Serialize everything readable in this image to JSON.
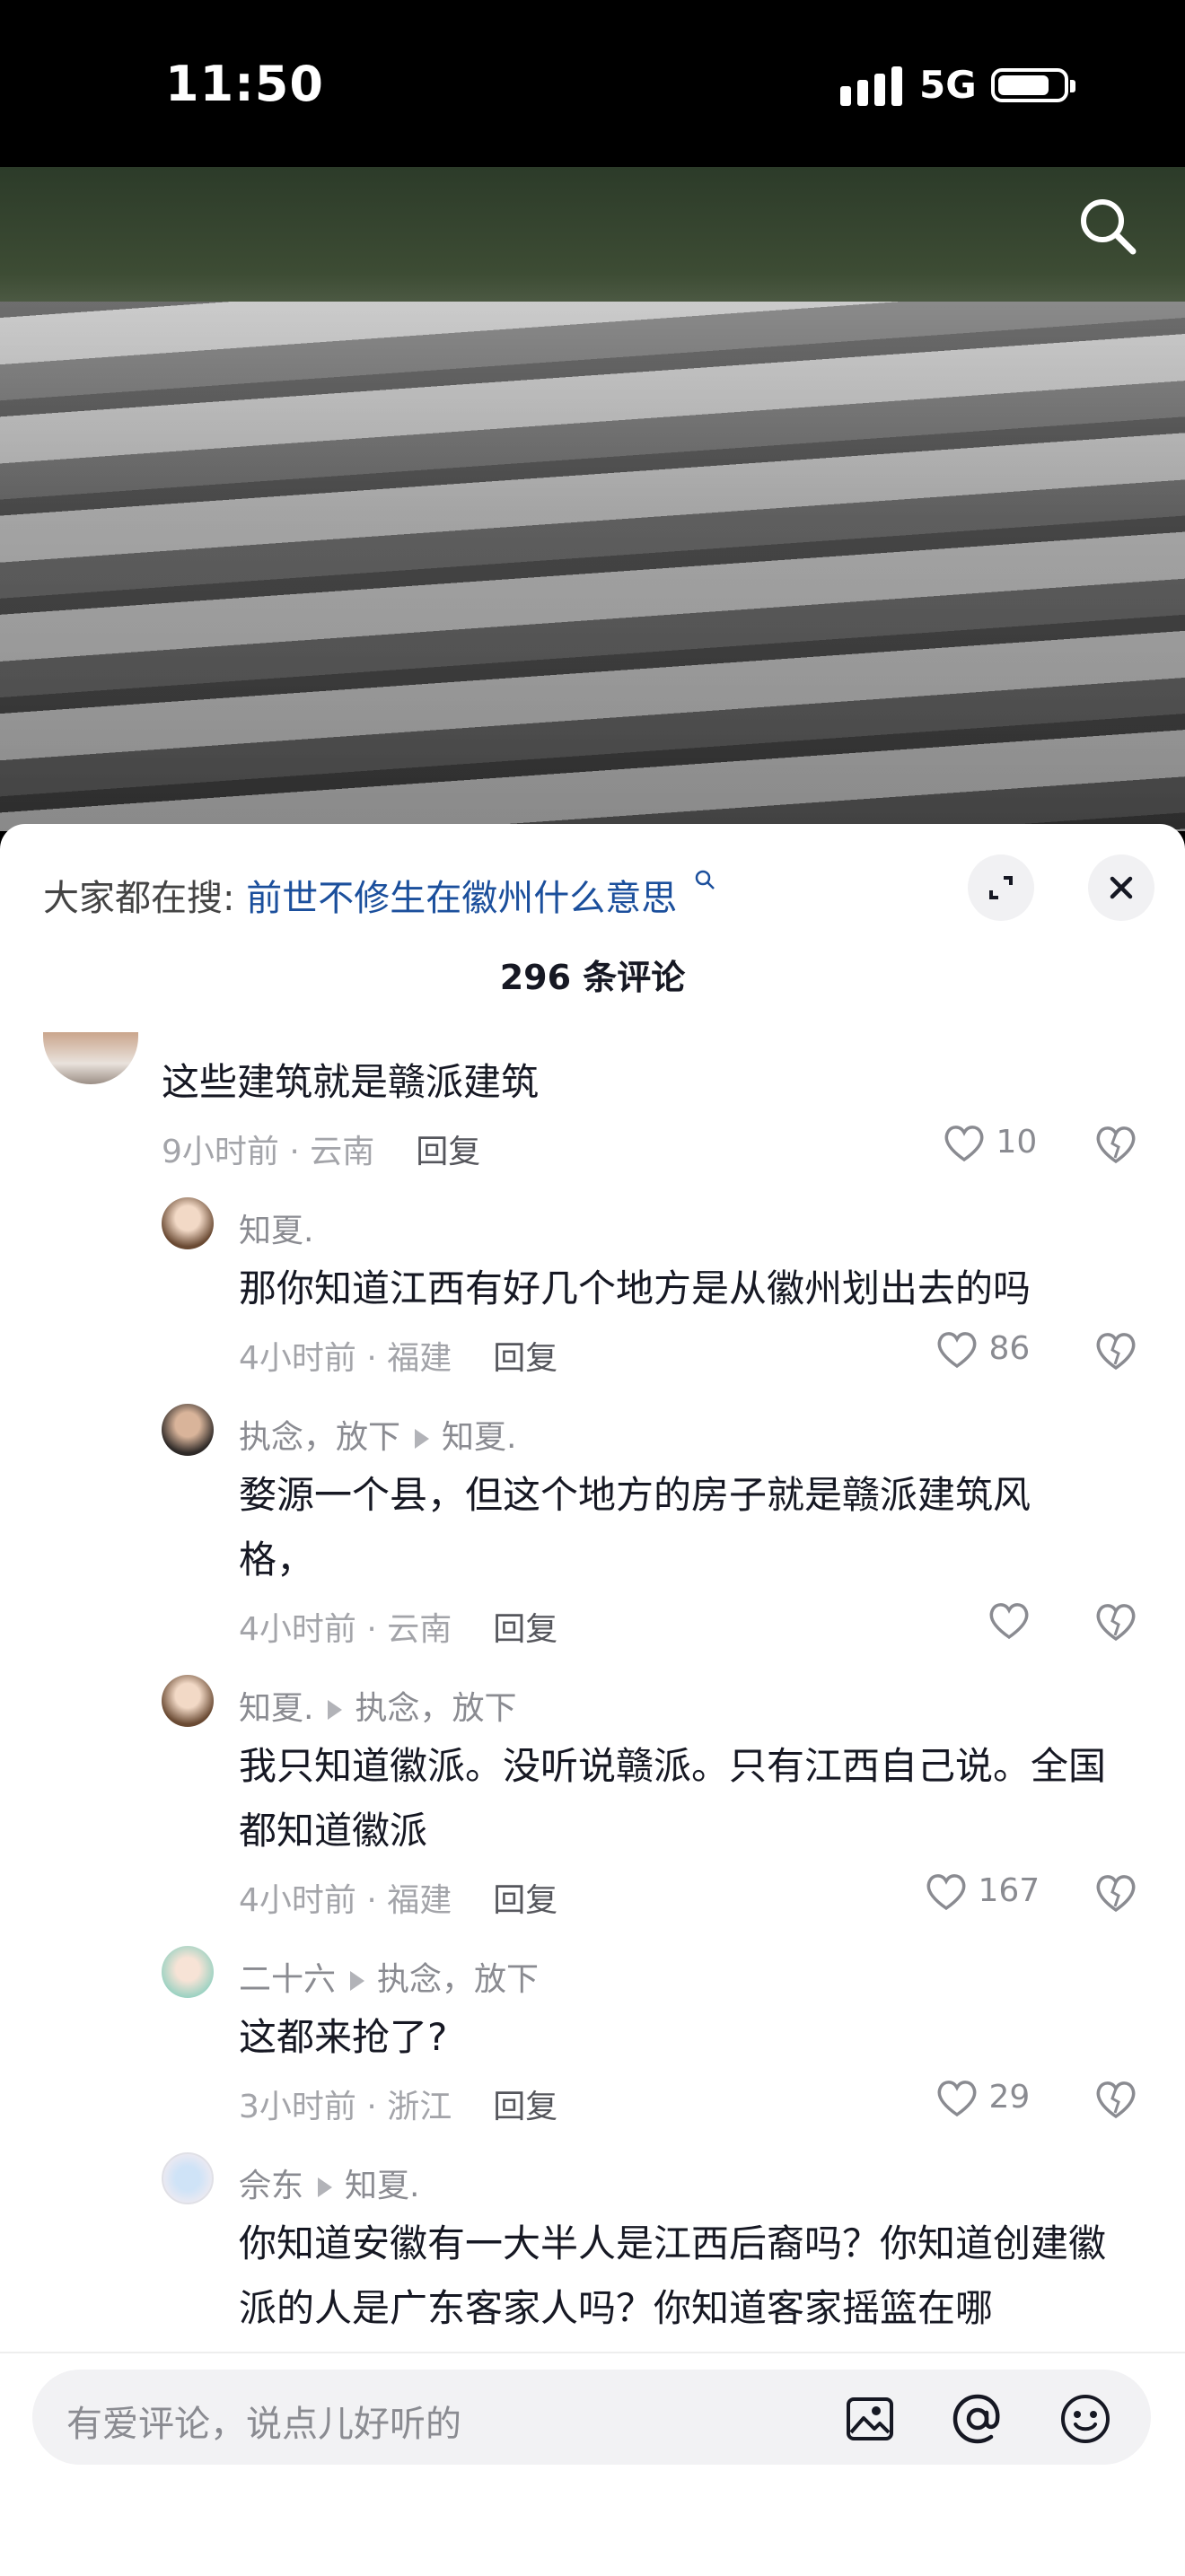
{
  "status_bar": {
    "time": "11:50",
    "network": "5G"
  },
  "sheet": {
    "hot_prefix": "大家都在搜:",
    "hot_query": "前世不修生在徽州什么意思",
    "comment_count": "296 条评论"
  },
  "comments": [
    {
      "text": "这些建筑就是赣派建筑",
      "time": "9小时前 · 云南",
      "reply": "回复",
      "likes": "10"
    },
    {
      "user": "知夏.",
      "text": "那你知道江西有好几个地方是从徽州划出去的吗",
      "time": "4小时前 · 福建",
      "reply": "回复",
      "likes": "86"
    },
    {
      "user": "执念，放下",
      "to": "知夏.",
      "text": "婺源一个县，但这个地方的房子就是赣派建筑风格，",
      "time": "4小时前 · 云南",
      "reply": "回复",
      "likes": ""
    },
    {
      "user": "知夏.",
      "to": "执念，放下",
      "text": "我只知道徽派。没听说赣派。只有江西自己说。全国都知道徽派",
      "time": "4小时前 · 福建",
      "reply": "回复",
      "likes": "167"
    },
    {
      "user": "二十六",
      "to": "执念，放下",
      "text": "这都来抢了?",
      "time": "3小时前 · 浙江",
      "reply": "回复",
      "likes": "29"
    },
    {
      "user": "佘东",
      "to": "知夏.",
      "text": "你知道安徽有一大半人是江西后裔吗？你知道创建徽派的人是广东客家人吗？你知道客家摇篮在哪"
    }
  ],
  "input": {
    "placeholder": "有爱评论，说点儿好听的"
  }
}
